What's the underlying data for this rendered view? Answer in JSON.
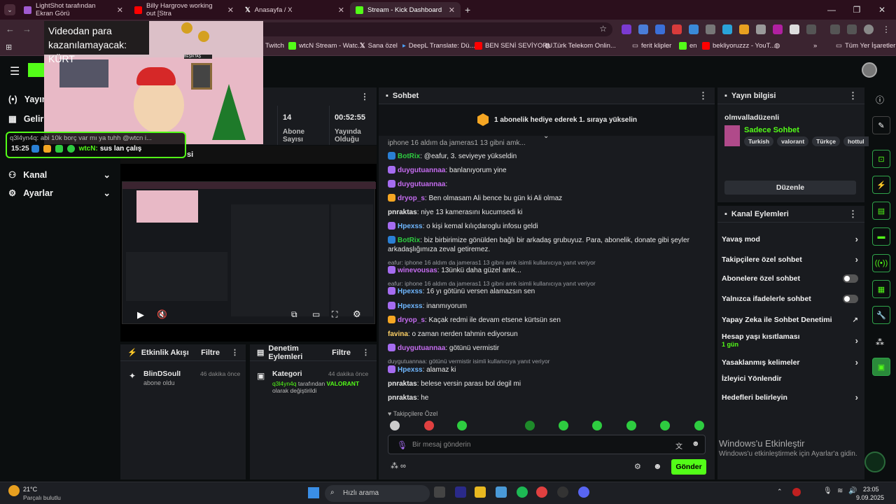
{
  "tabs": [
    {
      "title": "LightShot tarafından Ekran Görü"
    },
    {
      "title": "Billy Hargrove working out [Stra"
    },
    {
      "title": "Anasayfa / X"
    },
    {
      "title": "Stream - Kick Dashboard"
    }
  ],
  "bookmarks": [
    "Twitch",
    "wtcN Stream - Watc...",
    "Sana özel",
    "DeepL Translate: Dü...",
    "BEN SENİ SEVİYORU...",
    "Türk Telekom Onlin...",
    "ferit klipler",
    "en",
    "bekliyoruzzz - YouT...",
    "Tüm Yer İşaretleri"
  ],
  "overlay": {
    "title": "Videodan para kazanılamayacak: KÜRT",
    "banner": "BEŞİKTAŞ",
    "reply": "q3l4yn4q: abi 10k borç var mı ya tuhh @wtcn i...",
    "time": "15:25",
    "user": "wtcN:",
    "text": "sus lan çalış"
  },
  "sidebar": {
    "items": [
      "Yayın",
      "Gelir",
      "Kanal",
      "Ayarlar"
    ]
  },
  "stats": [
    {
      "value": "14",
      "label": "Abone Sayısı"
    },
    {
      "value": "00:52:55",
      "label": "Yayında Olduğu"
    }
  ],
  "video_title": "si",
  "activity": {
    "title": "Etkinlik Akışı",
    "filter": "Filtre",
    "user": "BlinDSoulI",
    "action": "abone oldu",
    "time": "46 dakika önce"
  },
  "moderation": {
    "title": "Denetim Eylemleri",
    "filter": "Filtre",
    "label": "Kategori",
    "time": "44 dakika önce",
    "who": "q3l4yn4q",
    "mid": "tarafından",
    "cat": "VALORANT",
    "tail": "olarak değiştirildi"
  },
  "chat": {
    "title": "Sohbet",
    "pinned": "1 abonelik hediye ederek 1. sıraya yükselin",
    "cut": "iphone 16 aldım da jameras1 13 gibni amk...",
    "messages": [
      {
        "user": "BotRix",
        "text": "@eafur, 3. seviyeye yükseldin",
        "color": "#2ecc40"
      },
      {
        "user": "duygutuannaa",
        "text": "banlanıyorum yine",
        "color": "#c56cf0"
      },
      {
        "user": "duygutuannaa",
        "text": "",
        "color": "#c56cf0"
      },
      {
        "user": "dryop_s",
        "text": "Ben olmasam Ali bence bu gün ki Ali olmaz",
        "color": "#c56cf0"
      },
      {
        "user": "pnraktas",
        "text": "niye 13 kamerasını kucumsedi ki",
        "color": "#e8e8e8"
      },
      {
        "user": "Hpexss",
        "text": "o kişi kemal kılıçdaroglu infosu geldi",
        "color": "#6fb7ff"
      },
      {
        "user": "BotRix",
        "text": "biz birbirimize gönülden bağlı bir arkadaş grubuyuz. Para, abonelik, donate gibi şeyler arkadaşlığımıza zeval getiremez.",
        "color": "#2ecc40"
      },
      {
        "reply": "eafur: iphone 16 aldım da jameras1 13 gibni amk isimli kullanıcıya yanıt veriyor",
        "user": "winevousas",
        "text": "13ünkü daha güzel amk...",
        "color": "#c56cf0"
      },
      {
        "reply": "eafur: iphone 16 aldım da jameras1 13 gibni amk isimli kullanıcıya yanıt veriyor",
        "user": "Hpexss",
        "text": "16 yı götünü versen alamazsın sen",
        "color": "#6fb7ff"
      },
      {
        "user": "Hpexss",
        "text": "inanmıyorum",
        "color": "#6fb7ff"
      },
      {
        "user": "dryop_s",
        "text": "Kaçak redmi ile devam etsene kürtsün sen",
        "color": "#c56cf0"
      },
      {
        "user": "favina",
        "text": "o zaman nerden tahmin ediyorsun",
        "color": "#ffd166"
      },
      {
        "user": "duygutuannaa",
        "text": "götünü vermistir",
        "color": "#c56cf0"
      },
      {
        "reply": "duygutuannaa: götünü vermistir isimli kullanıcıya yanıt veriyor",
        "user": "Hpexss",
        "text": "alamaz ki",
        "color": "#6fb7ff"
      },
      {
        "user": "pnraktas",
        "text": "belese versin parası bol degil mi",
        "color": "#e8e8e8"
      },
      {
        "user": "pnraktas",
        "text": "he",
        "color": "#e8e8e8"
      }
    ],
    "followers_label": "Takipçilere Özel",
    "input_placeholder": "Bir mesaj gönderin",
    "send": "Gönder"
  },
  "stream_info": {
    "title": "Yayın bilgisi",
    "stream_name": "olmvalladüzenli",
    "category": "Sadece Sohbet",
    "tags": [
      "Turkish",
      "valorant",
      "Türkçe",
      "hottul"
    ],
    "edit": "Düzenle"
  },
  "channel_actions": {
    "title": "Kanal Eylemleri",
    "items": [
      {
        "label": "Yavaş mod",
        "kind": "chevron"
      },
      {
        "label": "Takipçilere özel sohbet",
        "kind": "chevron"
      },
      {
        "label": "Abonelere özel sohbet",
        "kind": "toggle"
      },
      {
        "label": "Yalnızca ifadelerle sohbet",
        "kind": "toggle"
      },
      {
        "label": "Yapay Zeka ile Sohbet Denetimi",
        "kind": "ext"
      },
      {
        "label": "Hesap yaşı kısıtlaması",
        "sub": "1 gün",
        "kind": "chevron"
      },
      {
        "label": "Yasaklanmış kelimeler",
        "kind": "chevron"
      },
      {
        "label": "İzleyici Yönlendir",
        "kind": "none"
      },
      {
        "label": "Hedefleri belirleyin",
        "kind": "chevron"
      }
    ]
  },
  "watermark": {
    "title": "Windows'u Etkinleştir",
    "sub": "Windows'u etkinleştirmek için Ayarlar'a gidin."
  },
  "taskbar": {
    "temp": "21°C",
    "weather": "Parçalı bulutlu",
    "search": "Hızlı arama",
    "time": "23:05",
    "date": "9.09.2025"
  },
  "colors": {
    "kick_green": "#53fc18",
    "bg": "#0b0e0f",
    "panel": "#191b1f"
  }
}
